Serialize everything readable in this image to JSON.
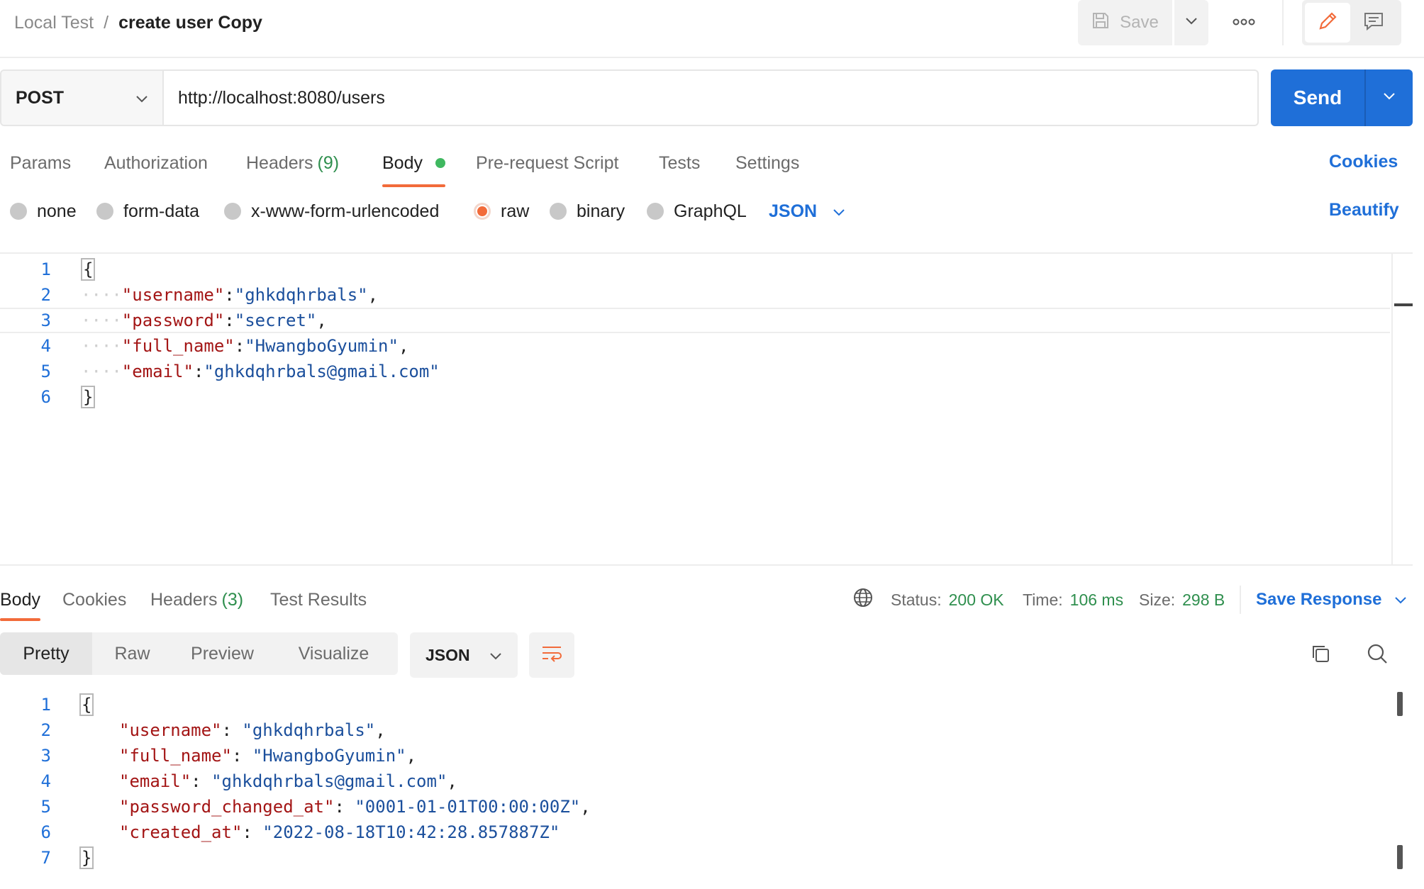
{
  "breadcrumb": {
    "parent": "Local Test",
    "separator": "/",
    "current": "create user Copy"
  },
  "toolbar": {
    "save_label": "Save"
  },
  "request": {
    "method": "POST",
    "url": "http://localhost:8080/users",
    "send_label": "Send"
  },
  "request_tabs": {
    "params": "Params",
    "authorization": "Authorization",
    "headers": "Headers",
    "headers_count": "(9)",
    "body": "Body",
    "prerequest": "Pre-request Script",
    "tests": "Tests",
    "settings": "Settings",
    "cookies": "Cookies"
  },
  "body_types": {
    "none": "none",
    "form_data": "form-data",
    "urlencoded": "x-www-form-urlencoded",
    "raw": "raw",
    "binary": "binary",
    "graphql": "GraphQL",
    "format": "JSON",
    "beautify": "Beautify"
  },
  "request_body": {
    "line_numbers": [
      "1",
      "2",
      "3",
      "4",
      "5",
      "6"
    ],
    "open": "{",
    "close": "}",
    "fields": [
      {
        "key": "\"username\"",
        "value": "\"ghkdqhrbals\"",
        "trail": ","
      },
      {
        "key": "\"password\"",
        "value": "\"secret\"",
        "trail": ","
      },
      {
        "key": "\"full_name\"",
        "value": "\"HwangboGyumin\"",
        "trail": ","
      },
      {
        "key": "\"email\"",
        "value": "\"ghkdqhrbals@gmail.com\"",
        "trail": ""
      }
    ]
  },
  "response_tabs": {
    "body": "Body",
    "cookies": "Cookies",
    "headers": "Headers",
    "headers_count": "(3)",
    "test_results": "Test Results"
  },
  "response_meta": {
    "status_label": "Status:",
    "status_value": "200 OK",
    "time_label": "Time:",
    "time_value": "106 ms",
    "size_label": "Size:",
    "size_value": "298 B",
    "save_response": "Save Response"
  },
  "response_view": {
    "pretty": "Pretty",
    "raw": "Raw",
    "preview": "Preview",
    "visualize": "Visualize",
    "format": "JSON"
  },
  "response_body": {
    "line_numbers": [
      "1",
      "2",
      "3",
      "4",
      "5",
      "6",
      "7"
    ],
    "open": "{",
    "close": "}",
    "fields": [
      {
        "key": "\"username\"",
        "value": "\"ghkdqhrbals\"",
        "trail": ","
      },
      {
        "key": "\"full_name\"",
        "value": "\"HwangboGyumin\"",
        "trail": ","
      },
      {
        "key": "\"email\"",
        "value": "\"ghkdqhrbals@gmail.com\"",
        "trail": ","
      },
      {
        "key": "\"password_changed_at\"",
        "value": "\"0001-01-01T00:00:00Z\"",
        "trail": ","
      },
      {
        "key": "\"created_at\"",
        "value": "\"2022-08-18T10:42:28.857887Z\"",
        "trail": ""
      }
    ]
  },
  "colors": {
    "accent_orange": "#f26b3a",
    "send_blue": "#1f6fd8",
    "status_green": "#2f8f4e",
    "json_key": "#a31515",
    "json_string": "#1b4f9c"
  },
  "icons": [
    "save-icon",
    "chevron-down-icon",
    "more-icon",
    "pencil-icon",
    "comment-icon",
    "globe-icon",
    "wrap-lines-icon",
    "copy-icon",
    "search-icon"
  ]
}
